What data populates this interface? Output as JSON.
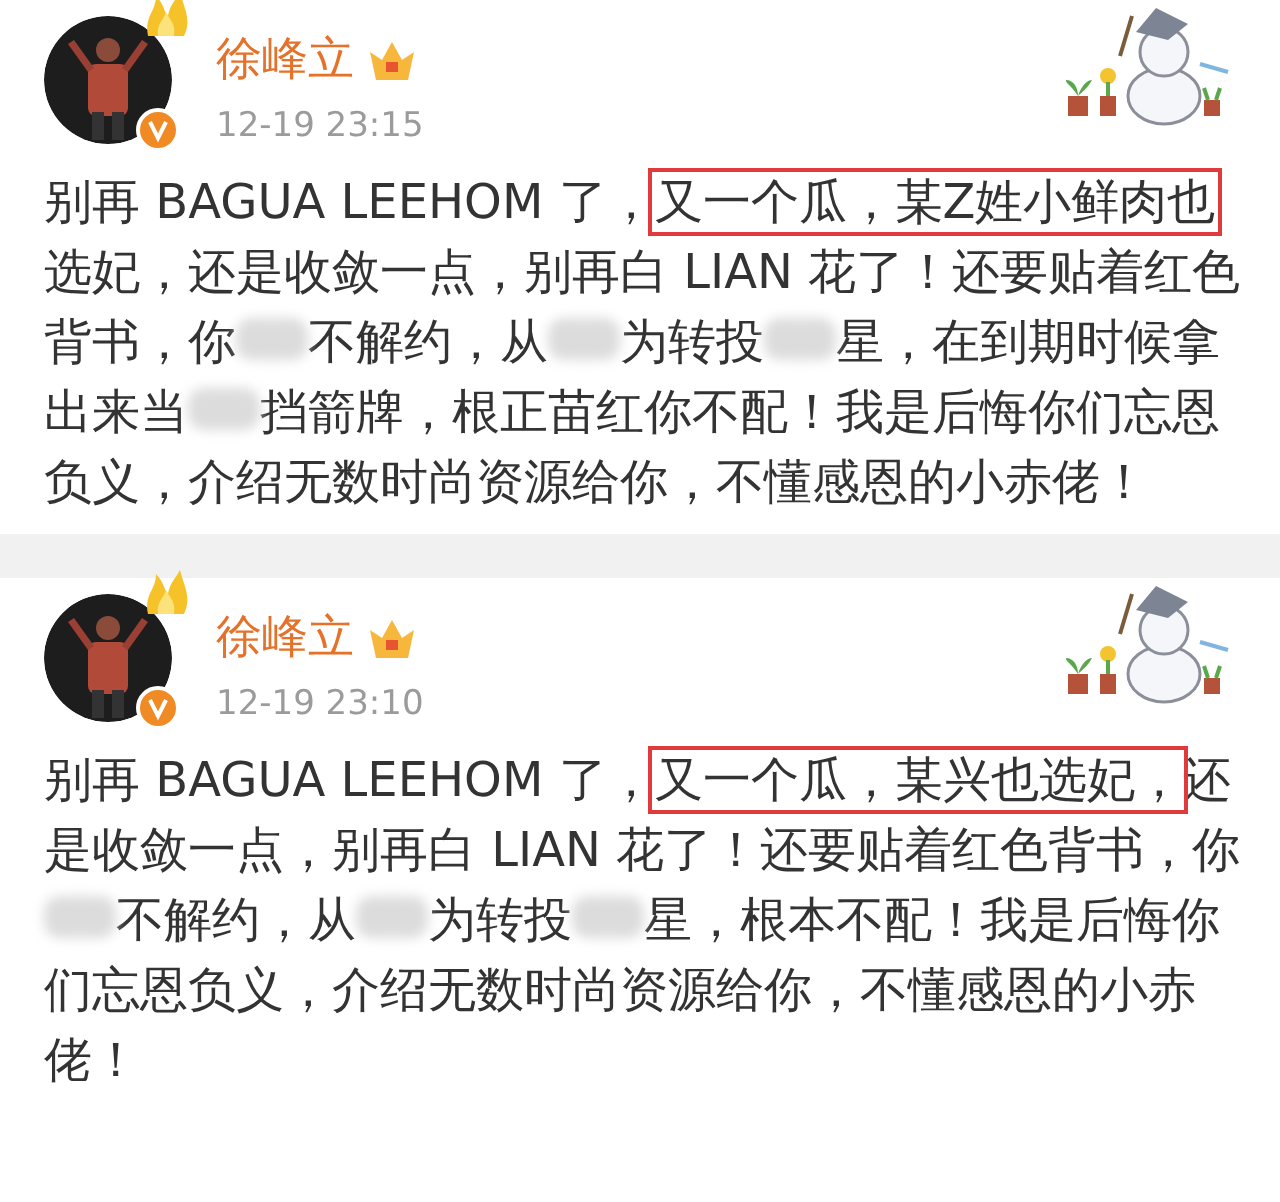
{
  "posts": [
    {
      "author": "徐峰立",
      "time": "12-19 23:15",
      "verified": true,
      "segments": [
        {
          "kind": "text",
          "text": "别再 BAGUA LEEHOM 了，"
        },
        {
          "kind": "highlight",
          "text": "又一个瓜，某Z姓小鲜肉也"
        },
        {
          "kind": "text",
          "text": "选妃，还是收敛一点，别再白 LIAN 花了！还要贴着红色背书，你"
        },
        {
          "kind": "blur"
        },
        {
          "kind": "text",
          "text": "不解约，从"
        },
        {
          "kind": "blur"
        },
        {
          "kind": "text",
          "text": "为转投"
        },
        {
          "kind": "blur"
        },
        {
          "kind": "text",
          "text": "星，在到期时候拿出来当"
        },
        {
          "kind": "blur"
        },
        {
          "kind": "text",
          "text": "挡箭牌，根正苗红你不配！我是后悔你们忘恩负义，介绍无数时尚资源给你，不懂感恩的小赤佬！"
        }
      ]
    },
    {
      "author": "徐峰立",
      "time": "12-19 23:10",
      "verified": true,
      "segments": [
        {
          "kind": "text",
          "text": "别再 BAGUA LEEHOM 了，"
        },
        {
          "kind": "highlight",
          "text": "又一个瓜，某兴也选妃，"
        },
        {
          "kind": "text",
          "text": "还是收敛一点，别再白 LIAN 花了！还要贴着红色背书，你"
        },
        {
          "kind": "blur"
        },
        {
          "kind": "text",
          "text": "不解约，从"
        },
        {
          "kind": "blur"
        },
        {
          "kind": "text",
          "text": "为转投"
        },
        {
          "kind": "blur"
        },
        {
          "kind": "text",
          "text": "星，根本不配！我是后悔你们忘恩负义，介绍无数时尚资源给你，不懂感恩的小赤佬！"
        }
      ]
    }
  ]
}
